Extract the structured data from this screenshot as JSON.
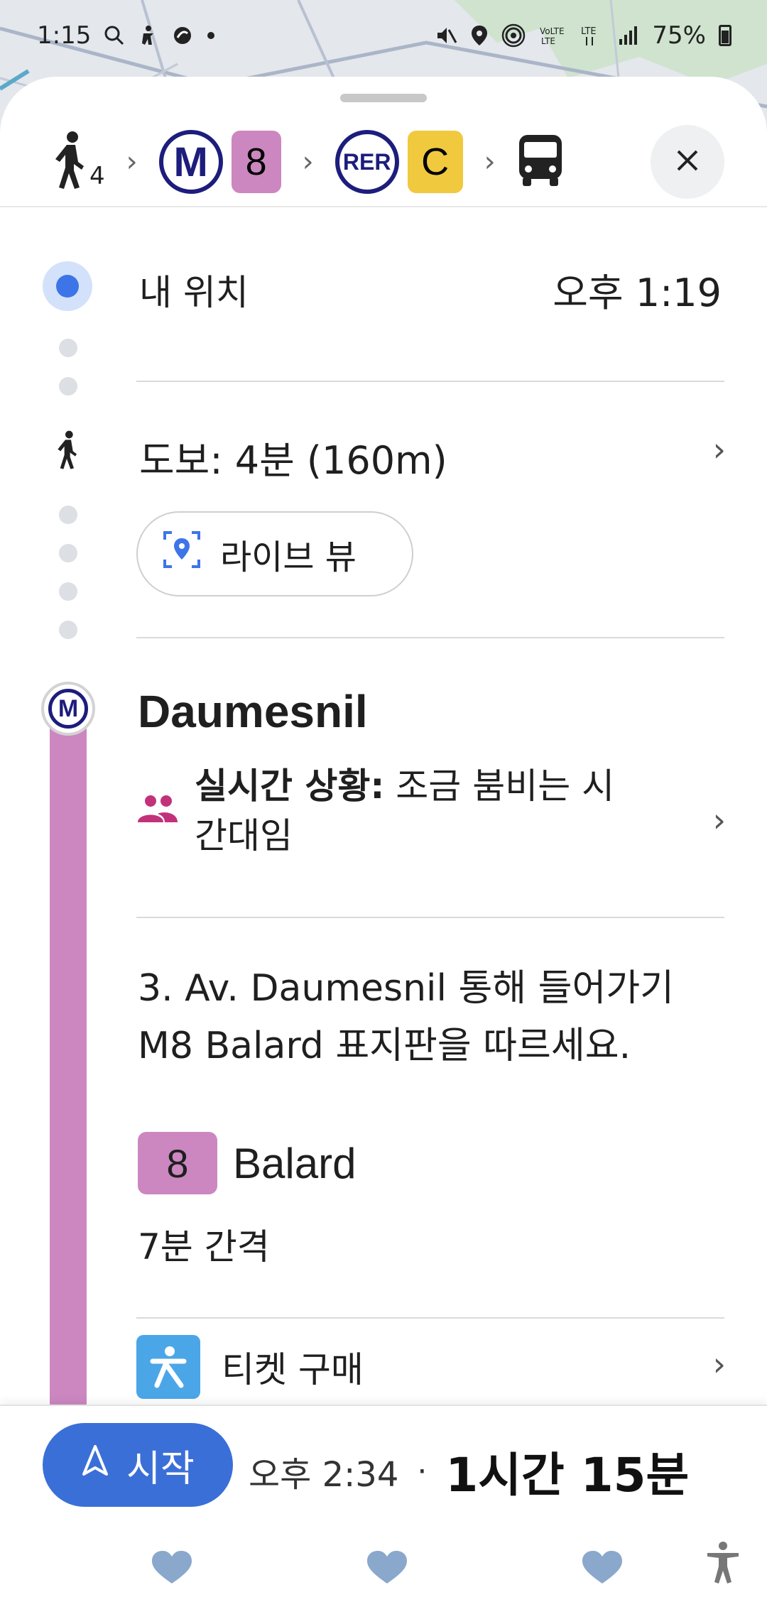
{
  "status_bar": {
    "time": "1:15",
    "battery": "75%"
  },
  "route_summary": {
    "walk_minutes": "4",
    "metro_label": "M",
    "metro_line": "8",
    "rer_label": "RER",
    "rer_line": "C"
  },
  "my_location": {
    "label": "내 위치",
    "time": "오후 1:19"
  },
  "walk_step": {
    "text": "도보: 4분 (160m)",
    "live_view_label": "라이브 뷰"
  },
  "station": {
    "icon_label": "M",
    "name": "Daumesnil",
    "crowd_bold": "실시간 상황:",
    "crowd_text": " 조금 붐비는 시간대임"
  },
  "directions": {
    "text": "3. Av. Daumesnil 통해 들어가기 M8 Balard 표지판을 따르세요."
  },
  "departure": {
    "line": "8",
    "destination": "Balard",
    "frequency": "7분 간격"
  },
  "ticket": {
    "label": "티켓 구매"
  },
  "bottom": {
    "start_label": "시작",
    "arrival_time": "오후 2:34",
    "separator": "·",
    "duration": "1시간 15분"
  },
  "colors": {
    "accent": "#3b6fd8",
    "metro_8": "#cc87c0",
    "rer_c": "#f0c93e",
    "ratp_blue": "#1d1d7d"
  }
}
